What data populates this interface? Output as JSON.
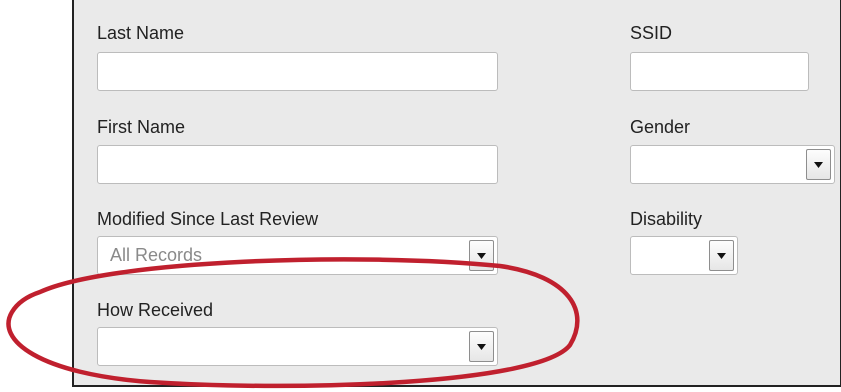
{
  "form": {
    "last_name": {
      "label": "Last Name",
      "value": ""
    },
    "ssid": {
      "label": "SSID",
      "value": ""
    },
    "first_name": {
      "label": "First Name",
      "value": ""
    },
    "gender": {
      "label": "Gender",
      "value": ""
    },
    "modified_since_last_review": {
      "label": "Modified Since Last Review",
      "value": "All Records"
    },
    "disability": {
      "label": "Disability",
      "value": ""
    },
    "how_received": {
      "label": "How Received",
      "value": ""
    }
  },
  "annotation": {
    "highlight_color": "#c0202e",
    "highlighted_field": "How Received"
  }
}
